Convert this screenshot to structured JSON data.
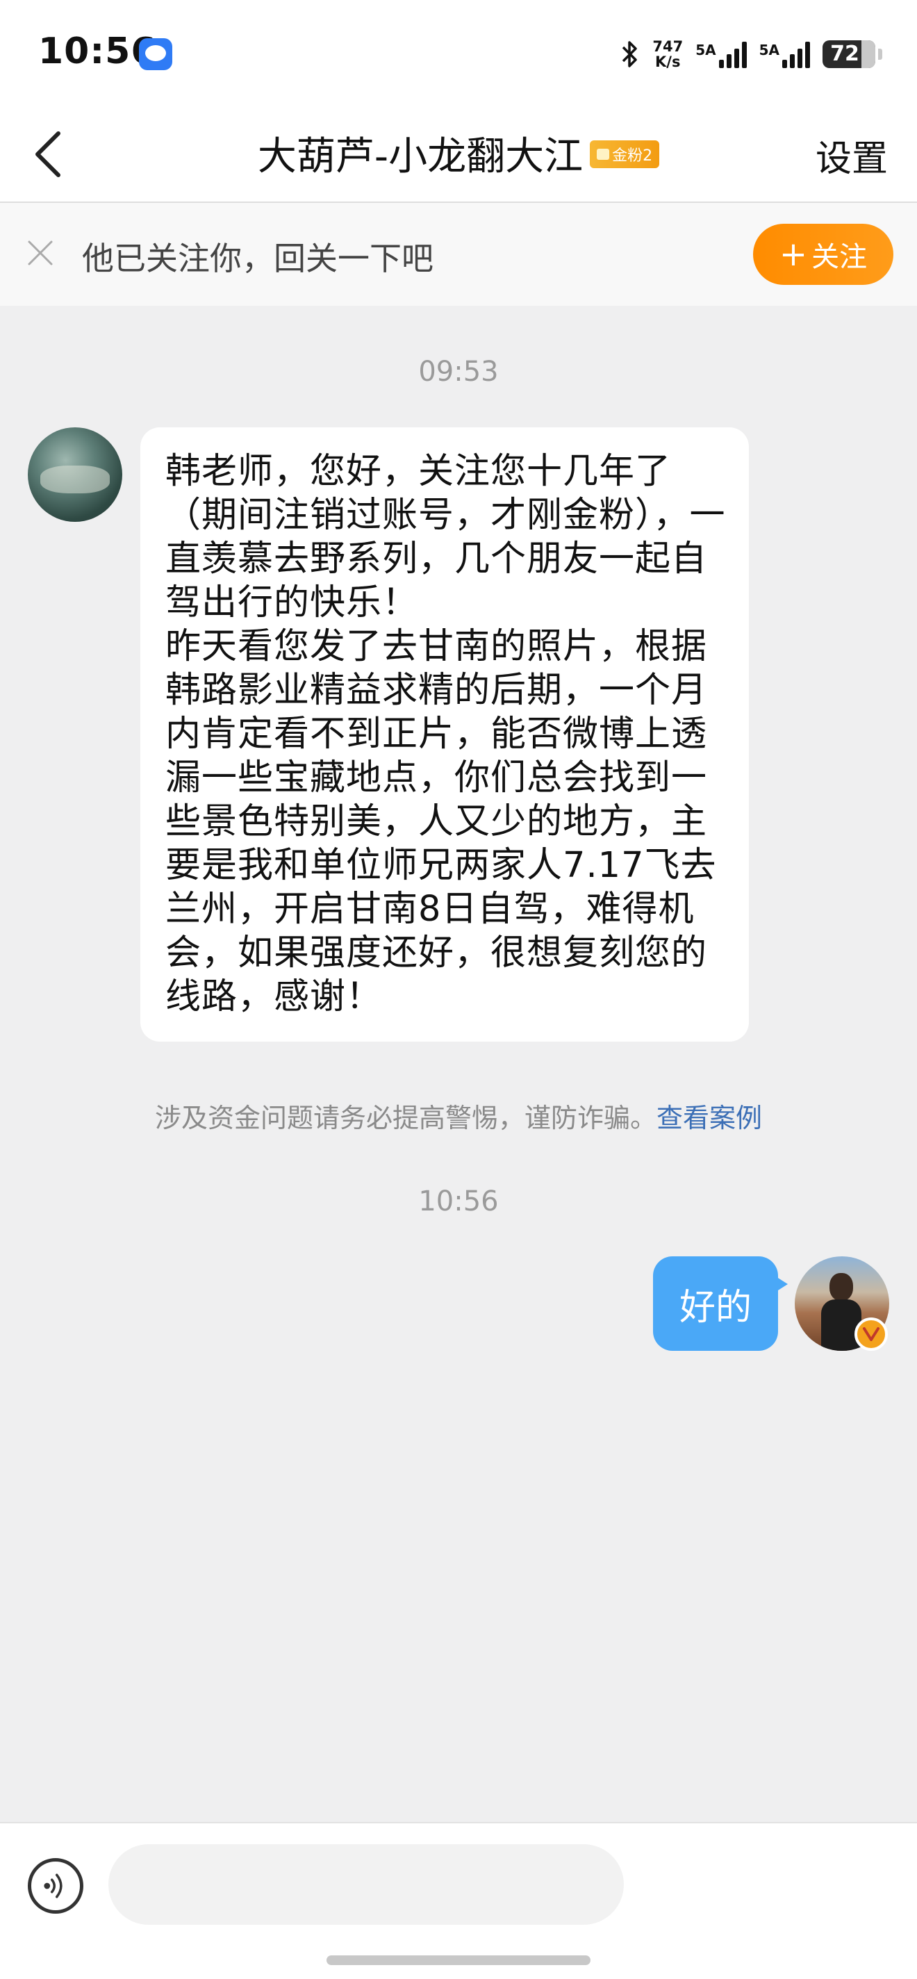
{
  "status_bar": {
    "time": "10:56",
    "net_speed_value": "747",
    "net_speed_unit": "K/s",
    "signal_1_label": "5A",
    "signal_2_label": "5A",
    "battery_level": "72"
  },
  "header": {
    "title": "大葫芦-小龙翻大江",
    "fan_badge": "金粉2",
    "settings_label": "设置"
  },
  "follow_banner": {
    "text": "他已关注你，回关一下吧",
    "button_plus": "+",
    "button_label": "关注"
  },
  "chat": {
    "timestamp_1": "09:53",
    "incoming_message": {
      "paragraph_1": "韩老师，您好，关注您十几年了（期间注销过账号，才刚金粉），一直羡慕去野系列，几个朋友一起自驾出行的快乐！",
      "paragraph_2": "昨天看您发了去甘南的照片，根据韩路影业精益求精的后期，一个月内肯定看不到正片，能否微博上透漏一些宝藏地点，你们总会找到一些景色特别美，人又少的地方，主要是我和单位师兄两家人7.17飞去兰州，开启甘南8日自驾，难得机会，如果强度还好，很想复刻您的线路，感谢！"
    },
    "warning_text": "涉及资金问题请务必提高警惕，谨防诈骗。",
    "warning_link": "查看案例",
    "timestamp_2": "10:56",
    "outgoing_message": "好的"
  },
  "colors": {
    "follow_orange": "#ff8c00",
    "outgoing_bubble": "#4aa8f7",
    "link_blue": "#3c6fb6",
    "verify_badge": "#f4a21d"
  },
  "icons": {
    "back": "chevron-left-icon",
    "close": "close-icon",
    "voice": "voice-icon",
    "verify": "verified-v-icon"
  }
}
